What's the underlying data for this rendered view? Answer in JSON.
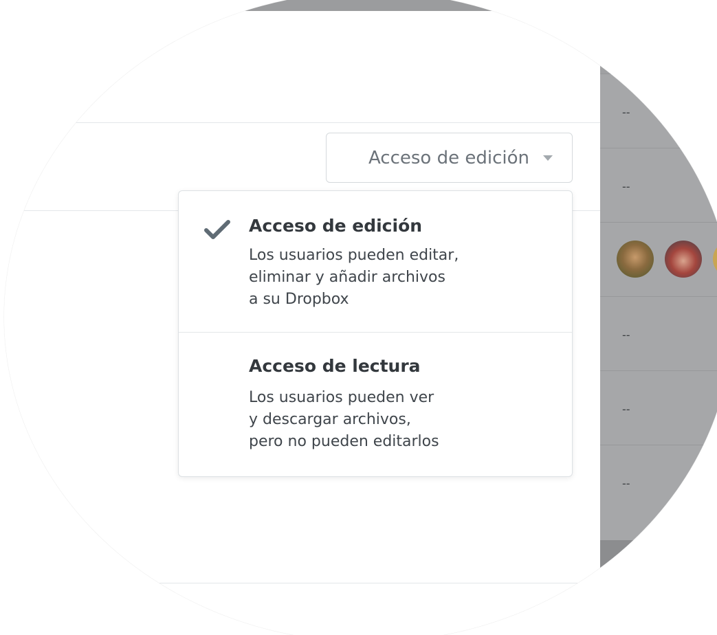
{
  "access_select": {
    "selected_label": "Acceso de edición",
    "caret_icon": "caret-down-icon"
  },
  "menu": {
    "options": [
      {
        "title": "Acceso de edición",
        "desc_lines": [
          "Los usuarios pueden editar,",
          "eliminar y añadir archivos",
          "a su Dropbox"
        ],
        "selected": true,
        "icon": "checkmark-icon"
      },
      {
        "title": "Acceso de lectura",
        "desc_lines": [
          "Los usuarios pueden ver",
          "y descargar archivos,",
          "pero no pueden editarlos"
        ],
        "selected": false
      }
    ]
  },
  "side_table": {
    "rows": [
      {
        "value": "--"
      },
      {
        "value": "--"
      },
      {
        "avatars": [
          "avatar-1",
          "avatar-2",
          "avatar-3"
        ]
      },
      {
        "value": "--"
      },
      {
        "value": "--"
      },
      {
        "value": "--"
      }
    ]
  },
  "colors": {
    "text_dark": "#33383d",
    "text_muted": "#6b7279",
    "border": "#d5d9dc",
    "checkmark": "#5f6b74",
    "overlay_gray": "#a6a7a9"
  }
}
